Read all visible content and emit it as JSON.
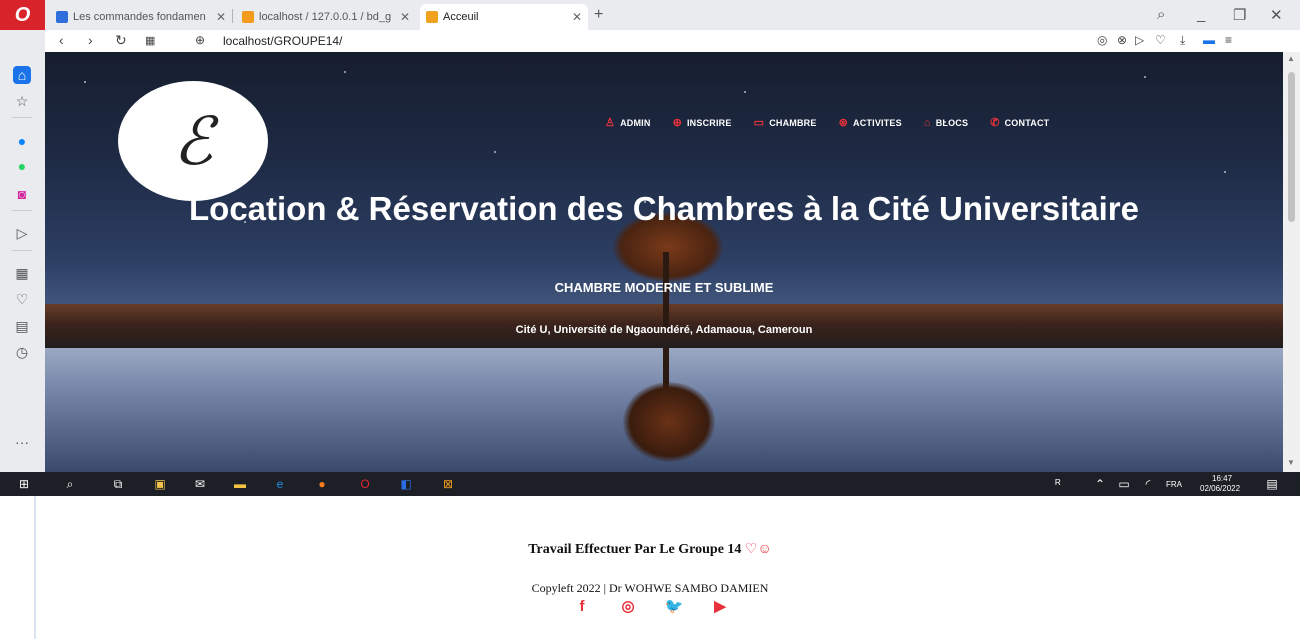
{
  "browser": {
    "tabs": [
      {
        "label": "Les commandes fondamen",
        "favicon_color": "#2f6fdc"
      },
      {
        "label": "localhost / 127.0.0.1 / bd_g",
        "favicon_color": "#f29b1d"
      },
      {
        "label": "Acceuil",
        "favicon_color": "#f2a31d"
      }
    ],
    "url": "localhost/GROUPE14/"
  },
  "site": {
    "menu": [
      {
        "label": "ADMIN",
        "icon": "user-icon"
      },
      {
        "label": "INSCRIRE",
        "icon": "plus-circle-icon"
      },
      {
        "label": "CHAMBRE",
        "icon": "bed-icon"
      },
      {
        "label": "ACTIVITES",
        "icon": "gamepad-icon"
      },
      {
        "label": "BLOCS",
        "icon": "home-icon"
      },
      {
        "label": "CONTACT",
        "icon": "phone-icon"
      }
    ],
    "hero_title": "Location & Réservation des Chambres à la Cité Universitaire",
    "hero_subtitle": "CHAMBRE MODERNE ET SUBLIME",
    "hero_address": "Cité U, Université de Ngaoundéré, Adamaoua, Cameroun"
  },
  "footer": {
    "title": "Travail Effectuer Par Le Groupe 14",
    "title_icons": "♡☺",
    "copyright": "Copyleft 2022 | Dr WOHWE SAMBO DAMIEN",
    "socials": [
      {
        "name": "facebook",
        "glyph": "f"
      },
      {
        "name": "instagram",
        "glyph": "◎"
      },
      {
        "name": "twitter",
        "glyph": "🐦"
      },
      {
        "name": "youtube",
        "glyph": "▶"
      }
    ]
  },
  "taskbar": {
    "language": "FRA",
    "time": "16:47",
    "date": "02/06/2022"
  },
  "colors": {
    "accent": "#e8313a",
    "browser_red": "#d8232a"
  }
}
